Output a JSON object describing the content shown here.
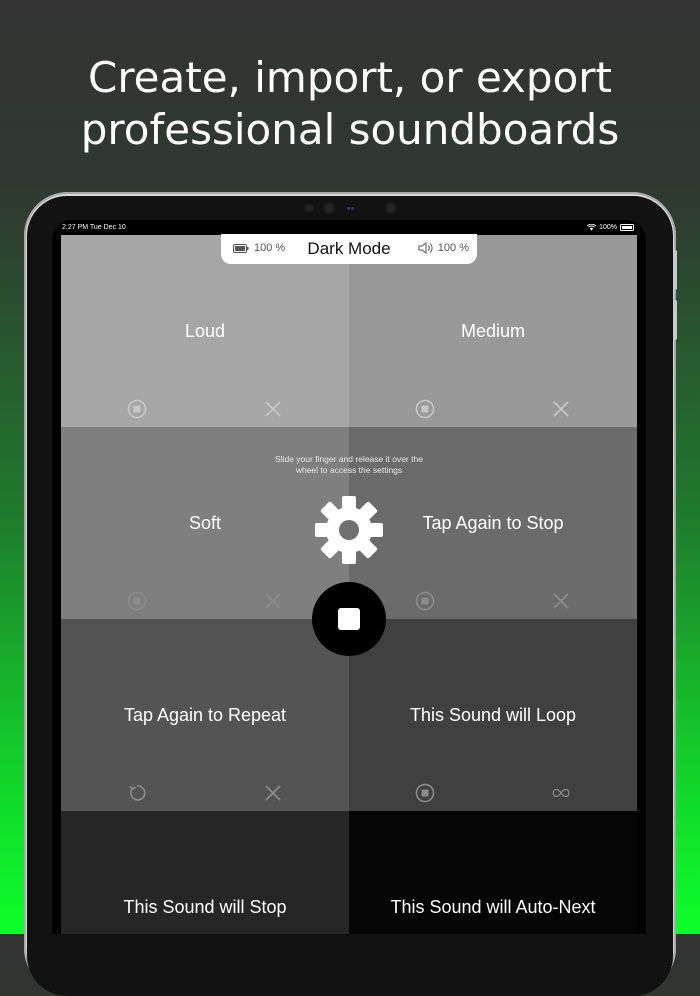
{
  "headline": {
    "line1": "Create, import, or export",
    "line2": "professional soundboards"
  },
  "status_bar": {
    "time": "2:27 PM  Tue Dec 10",
    "battery": "100%"
  },
  "top_bar": {
    "title": "Dark Mode",
    "battery_percent": "100 %",
    "volume_percent": "100 %"
  },
  "hint": "Slide your finger and release it over the wheel to access the settings",
  "tiles": [
    {
      "label": "Loud",
      "color": "#a6a6a6",
      "left_icon": "stop-circle-icon",
      "right_icon": "close-icon"
    },
    {
      "label": "Medium",
      "color": "#999999",
      "left_icon": "stop-circle-icon",
      "right_icon": "close-icon"
    },
    {
      "label": "Soft",
      "color": "#7f7f7f",
      "left_icon": "stop-circle-icon",
      "right_icon": "close-icon"
    },
    {
      "label": "Tap Again to Stop",
      "color": "#6b6b6b",
      "left_icon": "stop-circle-icon",
      "right_icon": "close-icon"
    },
    {
      "label": "Tap Again to Repeat",
      "color": "#545454",
      "left_icon": "repeat-icon",
      "right_icon": "close-icon"
    },
    {
      "label": "This Sound will Loop",
      "color": "#404040",
      "left_icon": "stop-circle-icon",
      "right_icon": "infinity-icon"
    },
    {
      "label": "This Sound will Stop",
      "color": "#262626",
      "left_icon": "",
      "right_icon": ""
    },
    {
      "label": "This Sound will Auto-Next",
      "color": "#050505",
      "left_icon": "",
      "right_icon": ""
    }
  ],
  "colors": {
    "icon_light": "#c8c8c8",
    "icon_mid": "#8c8c8c"
  }
}
